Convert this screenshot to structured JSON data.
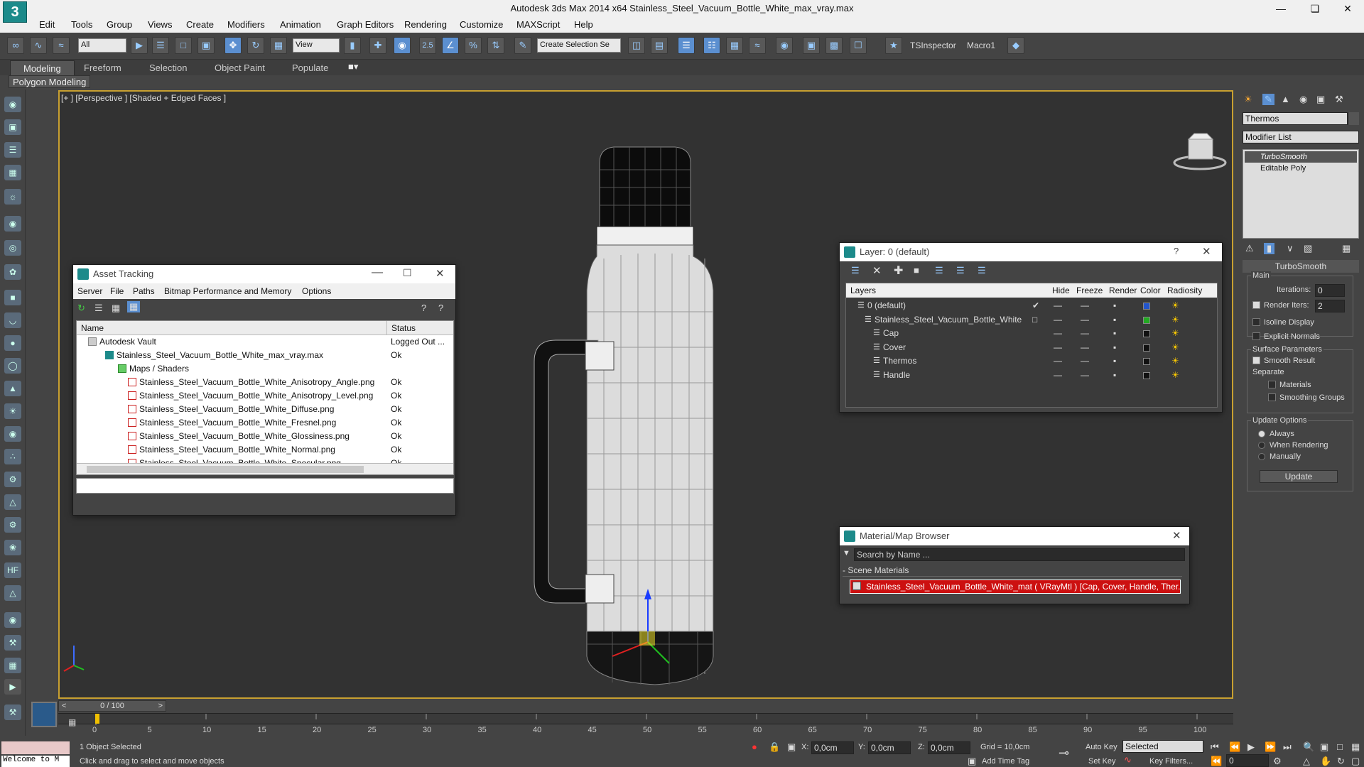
{
  "app": {
    "title": "Autodesk 3ds Max  2014 x64    Stainless_Steel_Vacuum_Bottle_White_max_vray.max",
    "logo": "3"
  },
  "menu": [
    "Edit",
    "Tools",
    "Group",
    "Views",
    "Create",
    "Modifiers",
    "Animation",
    "Graph Editors",
    "Rendering",
    "Customize",
    "MAXScript",
    "Help"
  ],
  "toolbar": {
    "filter": "All",
    "refcoord": "View",
    "selset": "Create Selection Se",
    "snap": "2.5",
    "ts_inspector": "TSInspector",
    "macro": "Macro1"
  },
  "ribbon": {
    "tabs": [
      "Modeling",
      "Freeform",
      "Selection",
      "Object Paint",
      "Populate"
    ],
    "sub": "Polygon Modeling"
  },
  "viewport": {
    "label": "[+ ] [Perspective ] [Shaded + Edged Faces ]"
  },
  "asset_tracking": {
    "title": "Asset Tracking",
    "menu": [
      "Server",
      "File",
      "Paths",
      "Bitmap Performance and Memory",
      "Options"
    ],
    "cols": [
      "Name",
      "Status"
    ],
    "rows": [
      {
        "name": "Autodesk Vault",
        "status": "Logged Out ..."
      },
      {
        "name": "Stainless_Steel_Vacuum_Bottle_White_max_vray.max",
        "status": "Ok"
      },
      {
        "name": "Maps / Shaders",
        "status": ""
      },
      {
        "name": "Stainless_Steel_Vacuum_Bottle_White_Anisotropy_Angle.png",
        "status": "Ok"
      },
      {
        "name": "Stainless_Steel_Vacuum_Bottle_White_Anisotropy_Level.png",
        "status": "Ok"
      },
      {
        "name": "Stainless_Steel_Vacuum_Bottle_White_Diffuse.png",
        "status": "Ok"
      },
      {
        "name": "Stainless_Steel_Vacuum_Bottle_White_Fresnel.png",
        "status": "Ok"
      },
      {
        "name": "Stainless_Steel_Vacuum_Bottle_White_Glossiness.png",
        "status": "Ok"
      },
      {
        "name": "Stainless_Steel_Vacuum_Bottle_White_Normal.png",
        "status": "Ok"
      },
      {
        "name": "Stainless_Steel_Vacuum_Bottle_White_Specular.png",
        "status": "Ok"
      }
    ]
  },
  "layer_win": {
    "title": "Layer: 0 (default)",
    "help": "?",
    "cols": [
      "Layers",
      "Hide",
      "Freeze",
      "Render",
      "Color",
      "Radiosity"
    ],
    "rows": [
      {
        "name": "0 (default)",
        "color": "#2255cc"
      },
      {
        "name": "Stainless_Steel_Vacuum_Bottle_White",
        "color": "#22aa22"
      },
      {
        "name": "Cap",
        "color": "#111111"
      },
      {
        "name": "Cover",
        "color": "#111111"
      },
      {
        "name": "Thermos",
        "color": "#111111"
      },
      {
        "name": "Handle",
        "color": "#111111"
      }
    ]
  },
  "material_browser": {
    "title": "Material/Map Browser",
    "search_placeholder": "Search by Name ...",
    "section": "- Scene Materials",
    "item": "Stainless_Steel_Vacuum_Bottle_White_mat  ( VRayMtl ) [Cap, Cover, Handle, Ther..."
  },
  "cmd": {
    "object_name": "Thermos",
    "modifier_list": "Modifier List",
    "stack": [
      "TurboSmooth",
      "Editable Poly"
    ],
    "rollout": "TurboSmooth",
    "main": "Main",
    "iterations_label": "Iterations:",
    "iterations": "0",
    "render_iters_label": "Render Iters:",
    "render_iters": "2",
    "isoline": "Isoline Display",
    "explicit": "Explicit Normals",
    "surface": "Surface Parameters",
    "smooth": "Smooth Result",
    "separate": "Separate",
    "materials": "Materials",
    "smoothing": "Smoothing Groups",
    "update_opts": "Update Options",
    "always": "Always",
    "when_rendering": "When Rendering",
    "manually": "Manually",
    "update": "Update"
  },
  "timeline": {
    "frame": "0 / 100",
    "ticks": [
      "0",
      "5",
      "10",
      "15",
      "20",
      "25",
      "30",
      "35",
      "40",
      "45",
      "50",
      "55",
      "60",
      "65",
      "70",
      "75",
      "80",
      "85",
      "90",
      "95",
      "100"
    ]
  },
  "status": {
    "welcome": "Welcome to M",
    "selected": "1 Object Selected",
    "hint": "Click and drag to select and move objects",
    "x": "0,0cm",
    "y": "0,0cm",
    "z": "0,0cm",
    "grid": "Grid = 10,0cm",
    "add_time_tag": "Add Time Tag",
    "auto_key": "Auto Key",
    "set_key": "Set Key",
    "selected_dd": "Selected",
    "key_filters": "Key Filters...",
    "frame": "0"
  }
}
